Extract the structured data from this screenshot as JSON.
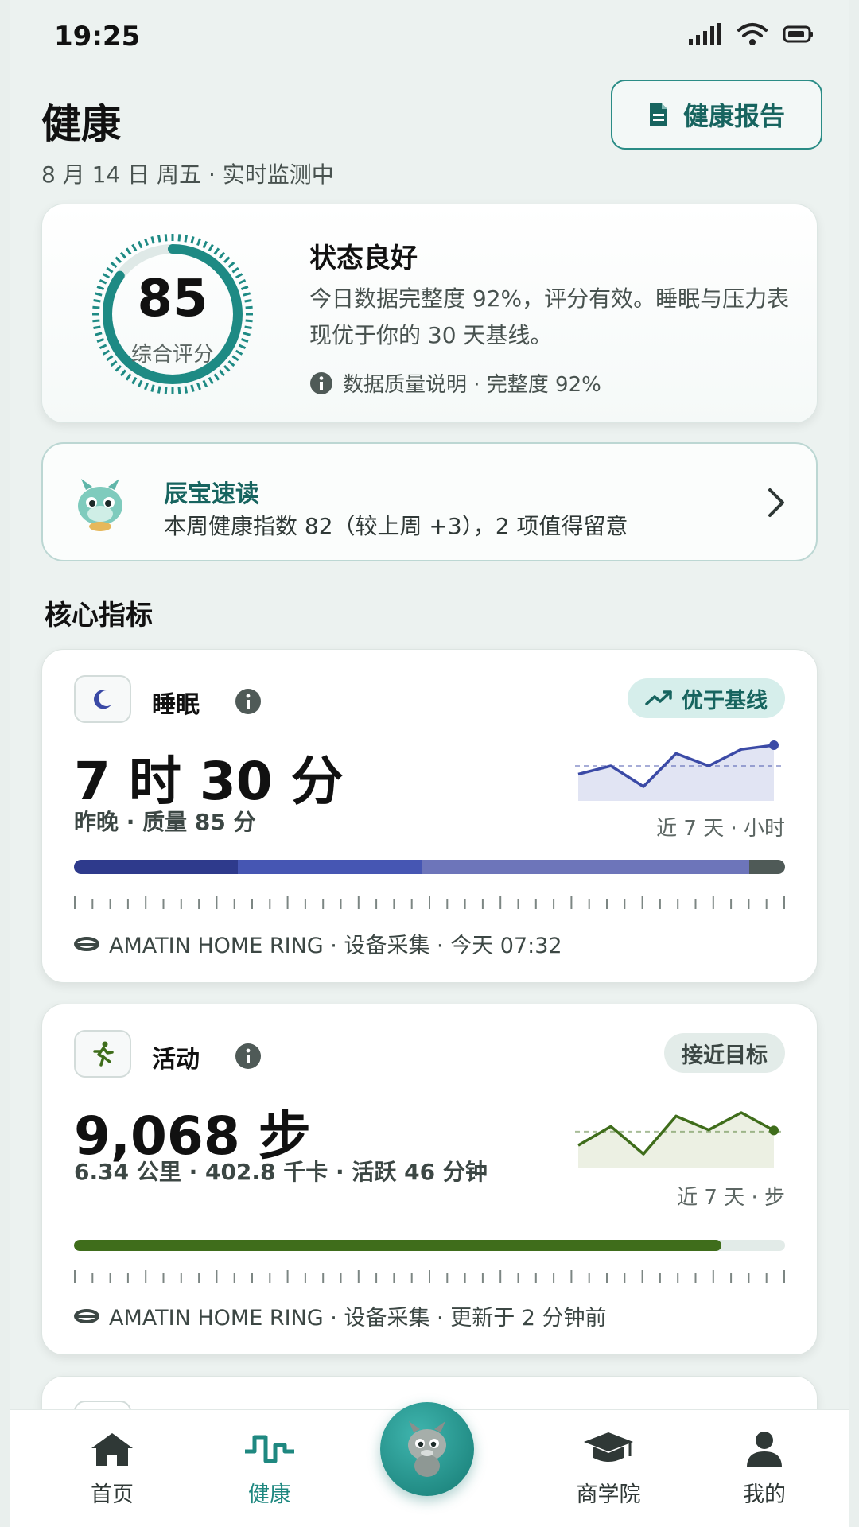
{
  "status_bar": {
    "time": "19:25"
  },
  "header": {
    "title": "健康",
    "subtitle": "8 月 14 日 周五 · 实时监测中",
    "report_button": "健康报告"
  },
  "score_card": {
    "score": "85",
    "score_label": "综合评分",
    "score_progress": 0.85,
    "title": "状态良好",
    "description": "今日数据完整度 92%，评分有效。睡眠与压力表现优于你的 30 天基线。",
    "meta": "数据质量说明 · 完整度 92%"
  },
  "brief": {
    "title": "辰宝速读",
    "text": "本周健康指数 82（较上周 +3），2 项值得留意"
  },
  "section": {
    "title": "核心指标"
  },
  "sleep": {
    "name": "睡眠",
    "badge": "优于基线",
    "value": "7 时 30 分",
    "sub": "昨晚 · 质量 85 分",
    "spark_caption": "近 7 天 · 小时",
    "spark_values": [
      6.8,
      7.0,
      6.5,
      7.3,
      7.0,
      7.4,
      7.5
    ],
    "spark_baseline": 7.0,
    "stage_fractions": [
      0.23,
      0.26,
      0.46,
      0.05
    ],
    "stage_colors": [
      "#2e3a8c",
      "#4656b3",
      "#6d75ba",
      "#4f5a57"
    ],
    "source": "AMATIN HOME RING · 设备采集 · 今天 07:32",
    "accent": "#3b4aa6"
  },
  "activity": {
    "name": "活动",
    "badge": "接近目标",
    "value": "9,068 步",
    "sub": "6.34 公里 · 402.8 千卡 · 活跃 46 分钟",
    "spark_caption": "近 7 天 · 步",
    "spark_values": [
      8200,
      9300,
      7700,
      9900,
      9100,
      10100,
      9068
    ],
    "spark_baseline": 9000,
    "goal_progress": 0.91,
    "source": "AMATIN HOME RING · 设备采集 · 更新于 2 分钟前",
    "accent": "#3f6d1b"
  },
  "bottom_nav": {
    "items": [
      {
        "label": "首页",
        "icon": "home-icon"
      },
      {
        "label": "健康",
        "icon": "pulse-icon"
      },
      {
        "label": "",
        "icon": "dragon-mascot-icon"
      },
      {
        "label": "商学院",
        "icon": "graduation-cap-icon"
      },
      {
        "label": "我的",
        "icon": "user-icon"
      }
    ]
  }
}
